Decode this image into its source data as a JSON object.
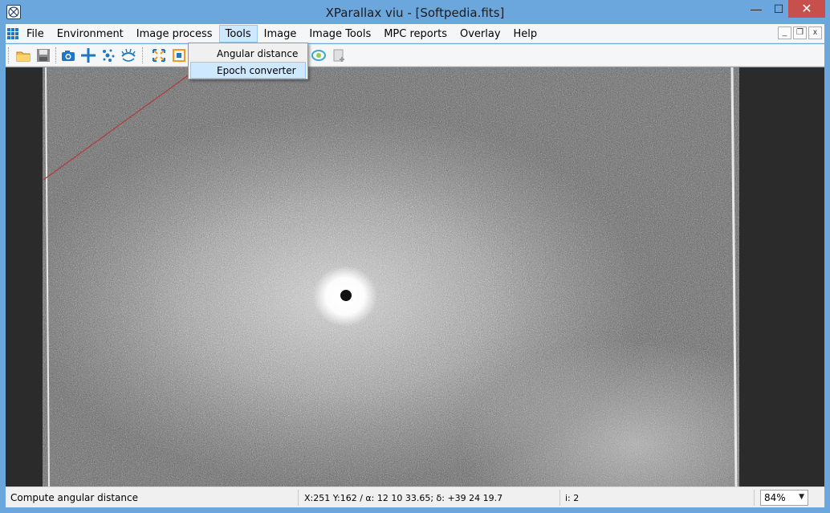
{
  "window": {
    "title": "XParallax viu - [Softpedia.fits]",
    "close_label": "✕",
    "minimize_label": "—",
    "maximize_label": "☐"
  },
  "menu": {
    "items": [
      {
        "label": "File"
      },
      {
        "label": "Environment"
      },
      {
        "label": "Image process"
      },
      {
        "label": "Tools"
      },
      {
        "label": "Image"
      },
      {
        "label": "Image Tools"
      },
      {
        "label": "MPC reports"
      },
      {
        "label": "Overlay"
      },
      {
        "label": "Help"
      }
    ],
    "active": "Tools",
    "mdi_min": "_",
    "mdi_restore": "❐",
    "mdi_close": "x"
  },
  "tools_menu": {
    "items": [
      {
        "label": "Angular distance"
      },
      {
        "label": "Epoch converter"
      }
    ],
    "highlighted": "Epoch converter"
  },
  "toolbar": {
    "icons": [
      "open-folder-icon",
      "save-disk-icon",
      "camera-icon",
      "crosshair-icon",
      "stars-icon",
      "eyelashes-icon",
      "expand-arrows-icon",
      "fit-frame-icon",
      "ring-icon",
      "new-document-icon"
    ]
  },
  "status": {
    "message": "Compute angular distance",
    "coordinates": "X:251 Y:162 / α: 12 10 33.65; δ: +39 24 19.7",
    "count": "i: 2",
    "zoom": "84%"
  },
  "colors": {
    "title_bg": "#6ba7dc",
    "close_bg": "#c7504c",
    "menu_highlight": "#cde8ff",
    "accent": "#1f77c4"
  }
}
